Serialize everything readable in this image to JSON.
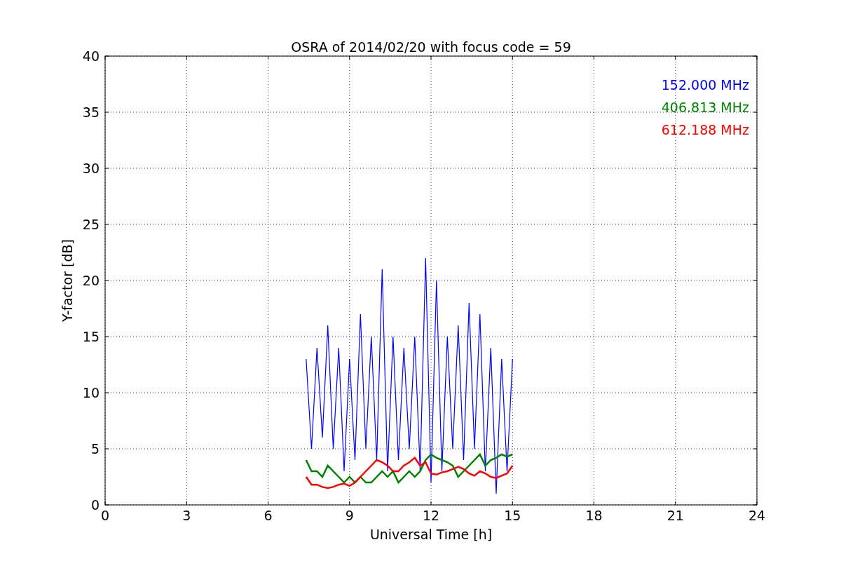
{
  "chart_data": {
    "type": "line",
    "title": "OSRA of 2014/02/20 with focus code = 59",
    "xlabel": "Universal Time [h]",
    "ylabel": "Y-factor [dB]",
    "x": [
      7.4,
      7.6,
      7.8,
      8.0,
      8.2,
      8.4,
      8.6,
      8.8,
      9.0,
      9.2,
      9.4,
      9.6,
      9.8,
      10.0,
      10.2,
      10.4,
      10.6,
      10.8,
      11.0,
      11.2,
      11.4,
      11.6,
      11.8,
      12.0,
      12.2,
      12.4,
      12.6,
      12.8,
      13.0,
      13.2,
      13.4,
      13.6,
      13.8,
      14.0,
      14.2,
      14.4,
      14.6,
      14.8,
      15.0
    ],
    "series": [
      {
        "name": "152.000 MHz",
        "color": "#0000ff",
        "values": [
          13,
          5,
          14,
          6,
          16,
          5,
          14,
          3,
          13,
          4,
          17,
          5,
          15,
          4,
          21,
          3,
          15,
          4,
          14,
          5,
          15,
          3,
          22,
          2,
          20,
          3,
          15,
          5,
          16,
          4,
          18,
          5,
          17,
          3,
          14,
          1,
          13,
          3,
          13
        ]
      },
      {
        "name": "406.813 MHz",
        "color": "#008000",
        "values": [
          4,
          3,
          3,
          2.5,
          3.5,
          3,
          2.5,
          2,
          2.5,
          2,
          2.5,
          2,
          2,
          2.5,
          3,
          2.5,
          3,
          2,
          2.5,
          3,
          2.5,
          3,
          4,
          4.5,
          4.2,
          4,
          3.8,
          3.5,
          2.5,
          3,
          3.5,
          4,
          4.5,
          3.5,
          4,
          4.2,
          4.5,
          4.3,
          4.5
        ]
      },
      {
        "name": "612.188 MHz",
        "color": "#ff0000",
        "values": [
          2.5,
          1.8,
          1.8,
          1.6,
          1.5,
          1.6,
          1.8,
          1.9,
          1.7,
          2,
          2.5,
          3,
          3.5,
          4,
          3.8,
          3.5,
          3,
          3,
          3.5,
          3.8,
          4.2,
          3.5,
          3.8,
          2.8,
          2.7,
          2.9,
          3,
          3.2,
          3.4,
          3.2,
          2.8,
          2.6,
          3,
          2.8,
          2.5,
          2.4,
          2.6,
          2.8,
          3.5
        ]
      }
    ],
    "xlim": [
      0,
      24
    ],
    "ylim": [
      0,
      40
    ],
    "xticks": [
      0,
      3,
      6,
      9,
      12,
      15,
      18,
      21,
      24
    ],
    "yticks": [
      0,
      5,
      10,
      15,
      20,
      25,
      30,
      35,
      40
    ],
    "grid": true
  }
}
